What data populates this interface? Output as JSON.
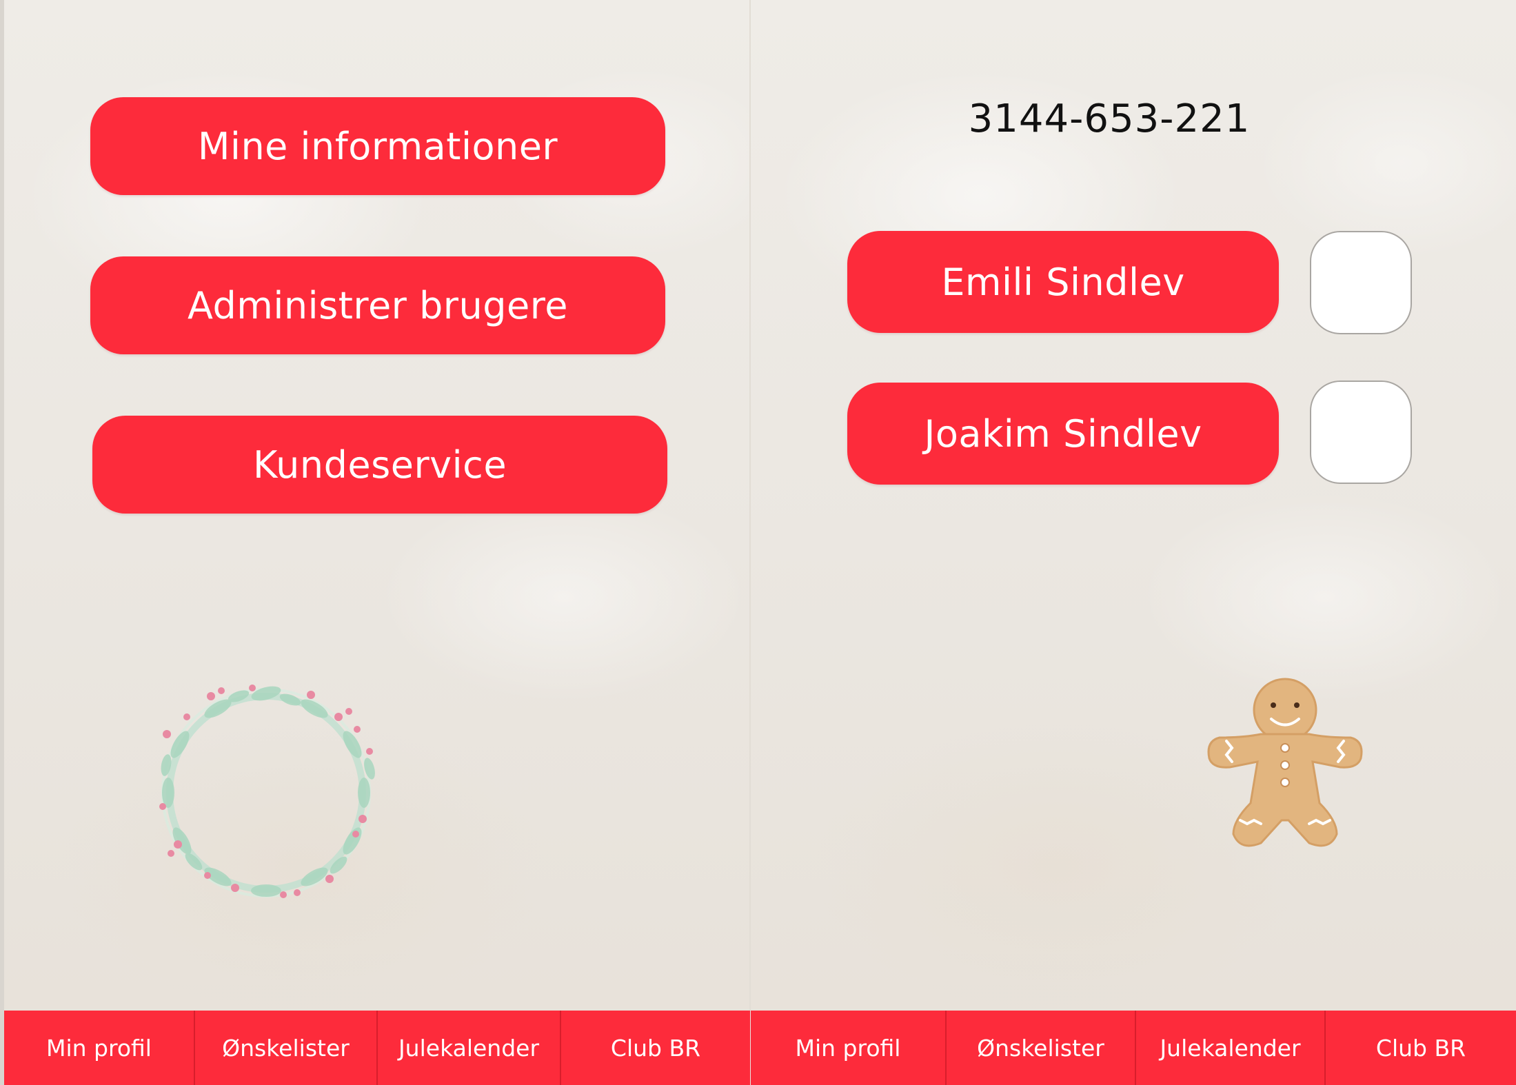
{
  "left_screen": {
    "menu_buttons": [
      {
        "label": "Mine informationer"
      },
      {
        "label": "Administrer brugere"
      },
      {
        "label": "Kundeservice"
      }
    ],
    "decoration": {
      "icon": "wreath-icon"
    },
    "tabbar": [
      {
        "label": "Min profil"
      },
      {
        "label": "Ønskelister"
      },
      {
        "label": "Julekalender"
      },
      {
        "label": "Club BR"
      }
    ]
  },
  "right_screen": {
    "code": "3144-653-221",
    "users": [
      {
        "name": "Emili Sindlev",
        "checked": false
      },
      {
        "name": "Joakim Sindlev",
        "checked": false
      }
    ],
    "decoration": {
      "icon": "gingerbread-man-icon"
    },
    "tabbar": [
      {
        "label": "Min profil"
      },
      {
        "label": "Ønskelister"
      },
      {
        "label": "Julekalender"
      },
      {
        "label": "Club BR"
      }
    ]
  },
  "colors": {
    "accent": "#fd2b3b",
    "background": "#ece8e2",
    "text_dark": "#111111",
    "text_light": "#ffffff"
  }
}
